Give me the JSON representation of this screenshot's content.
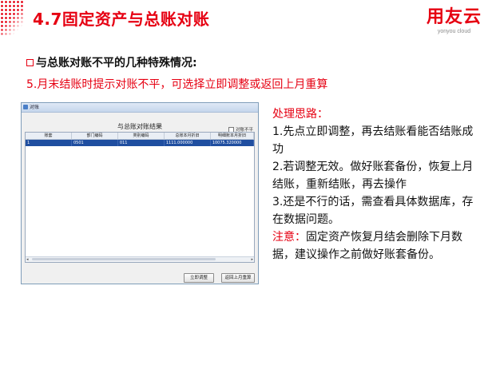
{
  "header": {
    "title": "4.7固定资产与总账对账",
    "logo_main": "用友云",
    "logo_sub": "yonyou cloud"
  },
  "bullet": {
    "text": "与总账对账不平的几种特殊情况:"
  },
  "subtitle": "5.月末结账时提示对账不平，可选择立即调整或返回上月重算",
  "dialog": {
    "window_title": "对账",
    "heading": "与总账对账结果",
    "checkbox_label": "对账不平",
    "columns": [
      "账套",
      "部门编码",
      "类别编码",
      "总账本月折旧",
      "明细账本月折旧"
    ],
    "rows": [
      [
        "1",
        "0501",
        "011",
        "1111.000000",
        "10075.320000"
      ]
    ],
    "buttons": {
      "adjust": "立即调整",
      "return": "返回上月重算"
    }
  },
  "solution": {
    "heading": "处理思路：",
    "items": [
      "1.先点立即调整，再去结账看能否结账成功",
      "2.若调整无效。做好账套备份，恢复上月结账，重新结账，再去操作",
      "3.还是不行的话，需查看具体数据库，存在数据问题。"
    ],
    "note_label": "注意：",
    "note_text": "固定资产恢复月结会删除下月数据，建议操作之前做好账套备份。"
  },
  "colors": {
    "brand_red": "#e60012"
  }
}
